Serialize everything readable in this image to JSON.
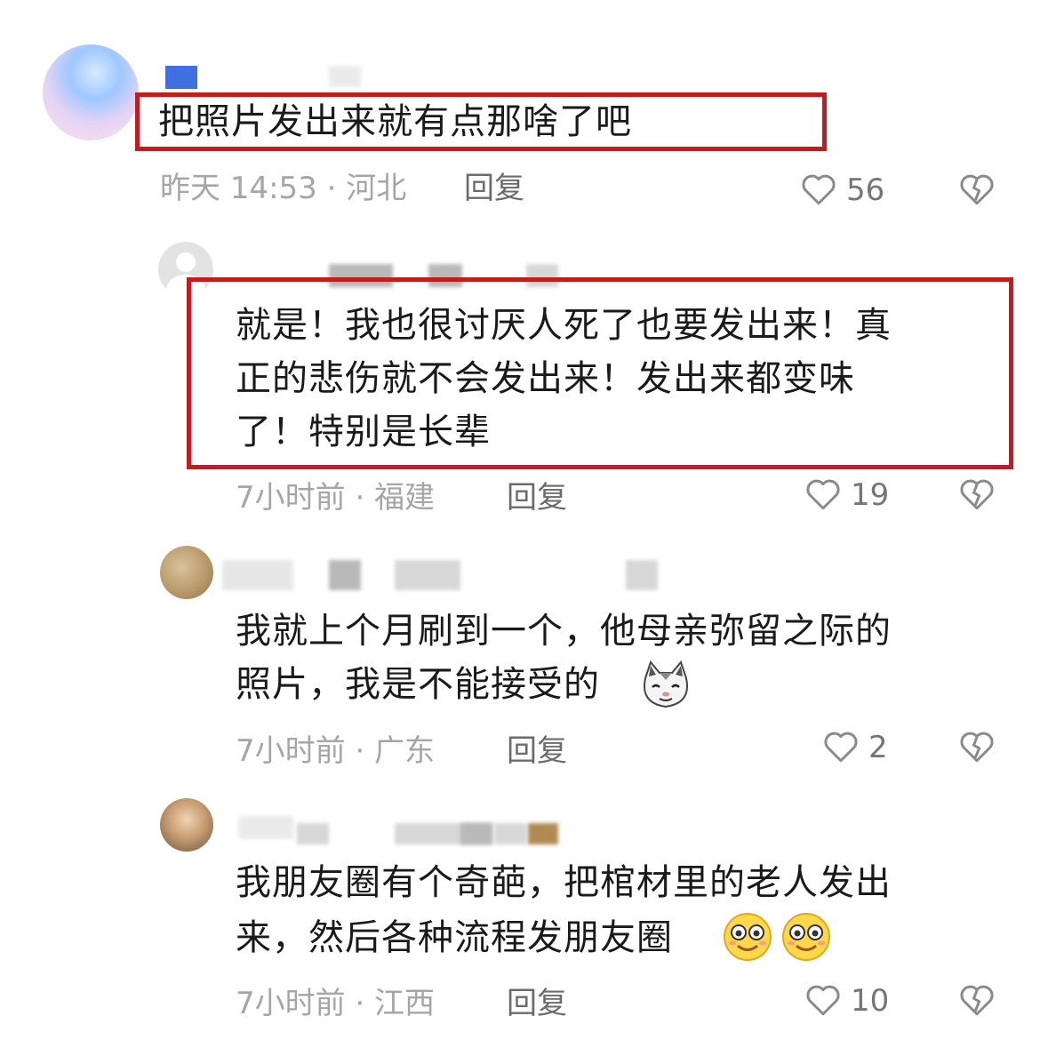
{
  "comments": [
    {
      "text_lines": [
        "把照片发出来就有点那啥了吧"
      ],
      "meta": "昨天 14:53 · 河北",
      "reply": "回复",
      "likes": "56"
    },
    {
      "text_lines": [
        "就是！我也很讨厌人死了也要发出来！真",
        "正的悲伤就不会发出来！发出来都变味",
        "了！特别是长辈"
      ],
      "meta": "7小时前 · 福建",
      "reply": "回复",
      "likes": "19"
    },
    {
      "text_lines": [
        "我就上个月刷到一个，他母亲弥留之际的",
        "照片，我是不能接受的"
      ],
      "meta": "7小时前 · 广东",
      "reply": "回复",
      "likes": "2",
      "emoji": "cat-face-icon"
    },
    {
      "text_lines": [
        "我朋友圈有个奇葩，把棺材里的老人发出",
        "来，然后各种流程发朋友圈"
      ],
      "meta": "7小时前 · 江西",
      "reply": "回复",
      "likes": "10",
      "emoji": "smile-face-icon"
    }
  ],
  "colors": {
    "highlight_box": "#c8191e",
    "meta_text": "#a6a6a6"
  },
  "icons": {
    "like": "heart-outline-icon",
    "dislike": "broken-heart-icon"
  }
}
